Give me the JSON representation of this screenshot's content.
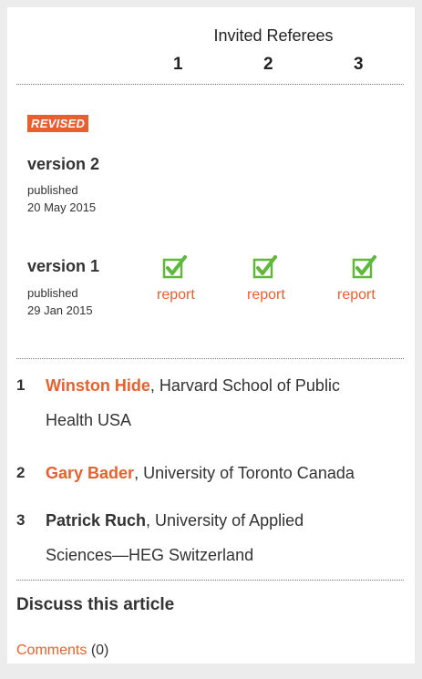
{
  "header": {
    "title": "Invited Referees",
    "referee_numbers": [
      "1",
      "2",
      "3"
    ]
  },
  "badge": "REVISED",
  "versions": [
    {
      "label": "version 2",
      "published_label": "published",
      "date": "20 May 2015"
    },
    {
      "label": "version 1",
      "published_label": "published",
      "date": "29 Jan 2015",
      "report_label": "report"
    }
  ],
  "referees": [
    {
      "num": "1",
      "name": "Winston Hide",
      "affil_line1": ", Harvard School of Public",
      "affil_line2": "Health USA"
    },
    {
      "num": "2",
      "name": "Gary Bader",
      "affil_line1": ", University of Toronto Canada"
    },
    {
      "num": "3",
      "name": "Patrick Ruch",
      "affil_line1": ", University of Applied",
      "affil_line2": "Sciences—HEG Switzerland"
    }
  ],
  "discuss": {
    "title": "Discuss this article",
    "comments_link": "Comments",
    "comments_count": "(0)"
  },
  "colors": {
    "accent": "#e8612c",
    "check": "#5fb83a"
  },
  "icons": {
    "check": "check-box-icon"
  }
}
